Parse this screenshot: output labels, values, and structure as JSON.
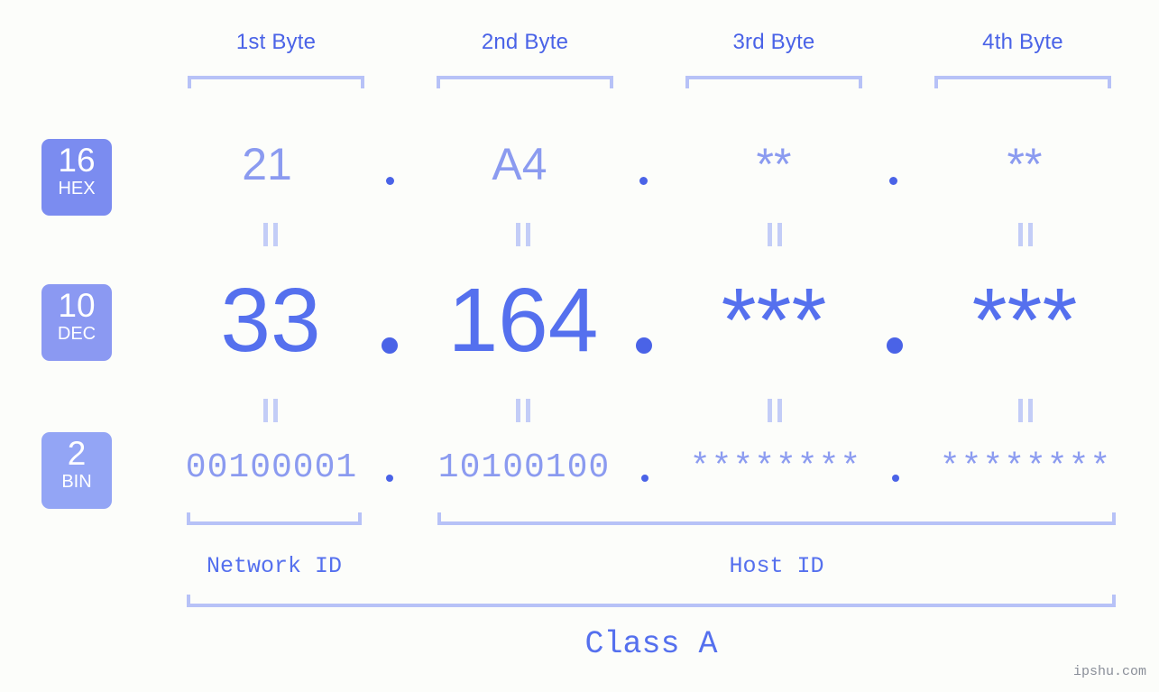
{
  "theme": {
    "background": "#fcfdfa",
    "accent_strong": "#4a63e7",
    "accent_dec": "#5570ee",
    "accent_light": "#8b9bf0",
    "bracket": "#b7c2f7",
    "equals": "#c3cdf7",
    "badge_hex": "#7b8cf0",
    "badge_dec": "#8b99f2",
    "badge_bin": "#93a5f5",
    "watermark": "#8a8f99"
  },
  "byte_headers": [
    {
      "label": "1st Byte"
    },
    {
      "label": "2nd Byte"
    },
    {
      "label": "3rd Byte"
    },
    {
      "label": "4th Byte"
    }
  ],
  "bases": [
    {
      "number": "16",
      "name": "HEX"
    },
    {
      "number": "10",
      "name": "DEC"
    },
    {
      "number": "2",
      "name": "BIN"
    }
  ],
  "rows": {
    "hex": {
      "values": [
        "21",
        "A4",
        "**",
        "**"
      ]
    },
    "dec": {
      "values": [
        "33",
        "164",
        "***",
        "***"
      ]
    },
    "bin": {
      "values": [
        "00100001",
        "10100100",
        "********",
        "********"
      ]
    }
  },
  "separators": {
    "dot": ".",
    "equals": "="
  },
  "id_labels": [
    {
      "label": "Network ID"
    },
    {
      "label": "Host ID"
    }
  ],
  "class_label": "Class A",
  "watermark": "ipshu.com"
}
